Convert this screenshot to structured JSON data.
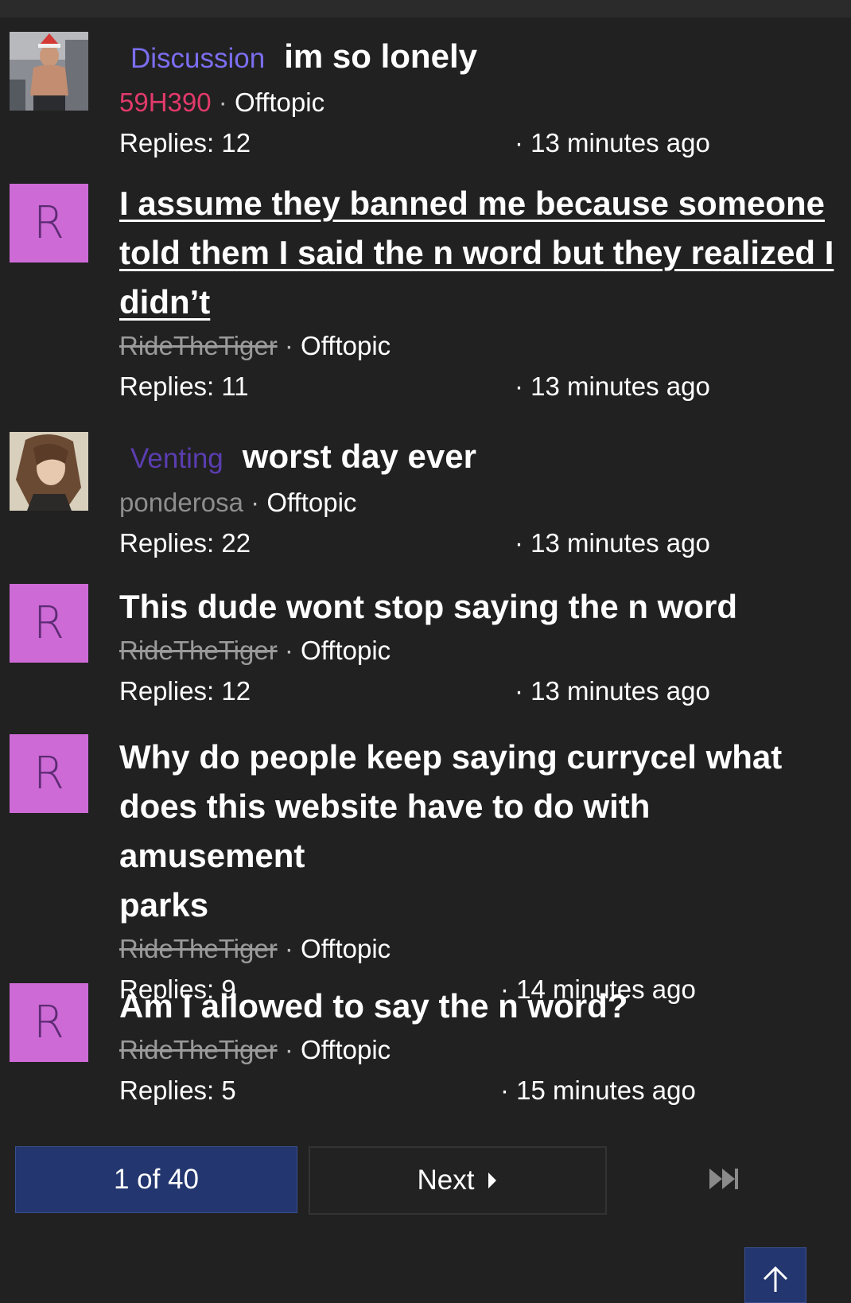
{
  "threads": [
    {
      "tag": "Discussion",
      "tag_color": "#7b6ef0",
      "title": "im so lonely",
      "author": "59H390",
      "author_style": "pink",
      "category": "Offtopic",
      "separator": "·",
      "replies": "Replies: 12",
      "time": "· 13 minutes ago",
      "avatar": "photo-man"
    },
    {
      "title_lines": [
        "I assume they banned me because someone",
        "told them I said the n word but they realized I",
        "didn’t"
      ],
      "author": "RideTheTiger",
      "author_style": "struck",
      "category": "Offtopic",
      "separator": "·",
      "replies": "Replies: 11",
      "time": "· 13 minutes ago",
      "avatar_letter": "R"
    },
    {
      "tag": "Venting",
      "tag_color": "#5a3db0",
      "title": "worst day ever",
      "author": "ponderosa",
      "author_style": "grey",
      "category": "Offtopic",
      "separator": "·",
      "replies": "Replies: 22",
      "time": "· 13 minutes ago",
      "avatar": "photo-anime"
    },
    {
      "title": "This dude wont stop saying the n word",
      "author": "RideTheTiger",
      "author_style": "struck",
      "category": "Offtopic",
      "separator": "·",
      "replies": "Replies: 12",
      "time": "· 13 minutes ago",
      "avatar_letter": "R"
    },
    {
      "title_lines": [
        "Why do people keep saying currycel what",
        "does this website have to do with amusement",
        "parks"
      ],
      "author": "RideTheTiger",
      "author_style": "struck",
      "category": "Offtopic",
      "separator": "·",
      "replies": "Replies: 9",
      "time": "· 14 minutes ago",
      "avatar_letter": "R"
    },
    {
      "title": "Am I allowed to say the n word?",
      "author": "RideTheTiger",
      "author_style": "struck",
      "category": "Offtopic",
      "separator": "·",
      "replies": "Replies: 5",
      "time": "· 15 minutes ago",
      "avatar_letter": "R"
    }
  ],
  "pager": {
    "current": "1 of 40",
    "next_label": "Next",
    "next_icon": "caret-right-icon",
    "last_icon": "fast-forward-icon"
  },
  "scroll_top_icon": "arrow-up-icon",
  "colors": {
    "background": "#212121",
    "avatar_letter_bg": "#cd6ad6",
    "avatar_letter_fg": "#5d2b73",
    "pager_active": "#23366f"
  }
}
